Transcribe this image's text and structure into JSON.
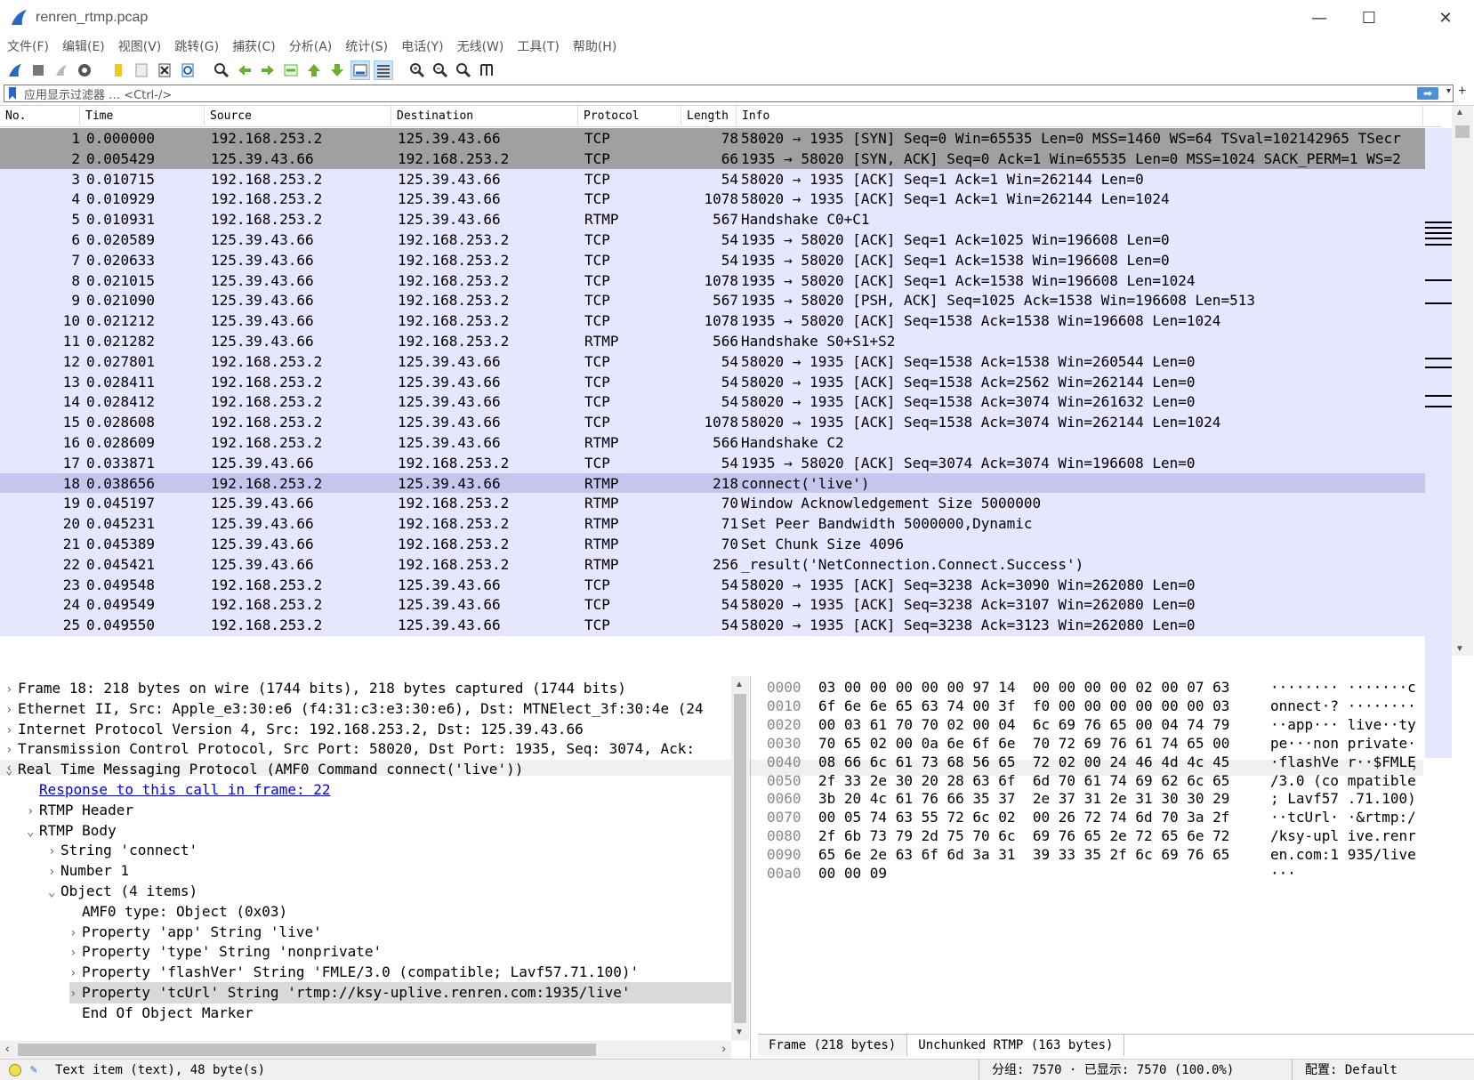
{
  "window": {
    "title": "renren_rtmp.pcap",
    "minimize": "—",
    "maximize": "☐",
    "close": "✕"
  },
  "menu": [
    "文件(F)",
    "编辑(E)",
    "视图(V)",
    "跳转(G)",
    "捕获(C)",
    "分析(A)",
    "统计(S)",
    "电话(Y)",
    "无线(W)",
    "工具(T)",
    "帮助(H)"
  ],
  "filter": {
    "placeholder": "应用显示过滤器 … <Ctrl-/>",
    "apply": "➡",
    "dropdown": "▾",
    "add": "+"
  },
  "packet_list": {
    "columns": [
      "No.",
      "Time",
      "Source",
      "Destination",
      "Protocol",
      "Length",
      "Info"
    ],
    "rows": [
      {
        "no": "1",
        "time": "0.000000",
        "src": "192.168.253.2",
        "dst": "125.39.43.66",
        "proto": "TCP",
        "len": "78",
        "info": "58020 → 1935 [SYN] Seq=0 Win=65535 Len=0 MSS=1460 WS=64 TSval=102142965 TSecr",
        "style": "hl"
      },
      {
        "no": "2",
        "time": "0.005429",
        "src": "125.39.43.66",
        "dst": "192.168.253.2",
        "proto": "TCP",
        "len": "66",
        "info": "1935 → 58020 [SYN, ACK] Seq=0 Ack=1 Win=65535 Len=0 MSS=1024 SACK_PERM=1 WS=2",
        "style": "hl"
      },
      {
        "no": "3",
        "time": "0.010715",
        "src": "192.168.253.2",
        "dst": "125.39.43.66",
        "proto": "TCP",
        "len": "54",
        "info": "58020 → 1935 [ACK] Seq=1 Ack=1 Win=262144 Len=0",
        "style": ""
      },
      {
        "no": "4",
        "time": "0.010929",
        "src": "192.168.253.2",
        "dst": "125.39.43.66",
        "proto": "TCP",
        "len": "1078",
        "info": "58020 → 1935 [ACK] Seq=1 Ack=1 Win=262144 Len=1024",
        "style": ""
      },
      {
        "no": "5",
        "time": "0.010931",
        "src": "192.168.253.2",
        "dst": "125.39.43.66",
        "proto": "RTMP",
        "len": "567",
        "info": "Handshake C0+C1",
        "style": ""
      },
      {
        "no": "6",
        "time": "0.020589",
        "src": "125.39.43.66",
        "dst": "192.168.253.2",
        "proto": "TCP",
        "len": "54",
        "info": "1935 → 58020 [ACK] Seq=1 Ack=1025 Win=196608 Len=0",
        "style": ""
      },
      {
        "no": "7",
        "time": "0.020633",
        "src": "125.39.43.66",
        "dst": "192.168.253.2",
        "proto": "TCP",
        "len": "54",
        "info": "1935 → 58020 [ACK] Seq=1 Ack=1538 Win=196608 Len=0",
        "style": ""
      },
      {
        "no": "8",
        "time": "0.021015",
        "src": "125.39.43.66",
        "dst": "192.168.253.2",
        "proto": "TCP",
        "len": "1078",
        "info": "1935 → 58020 [ACK] Seq=1 Ack=1538 Win=196608 Len=1024",
        "style": ""
      },
      {
        "no": "9",
        "time": "0.021090",
        "src": "125.39.43.66",
        "dst": "192.168.253.2",
        "proto": "TCP",
        "len": "567",
        "info": "1935 → 58020 [PSH, ACK] Seq=1025 Ack=1538 Win=196608 Len=513",
        "style": ""
      },
      {
        "no": "10",
        "time": "0.021212",
        "src": "125.39.43.66",
        "dst": "192.168.253.2",
        "proto": "TCP",
        "len": "1078",
        "info": "1935 → 58020 [ACK] Seq=1538 Ack=1538 Win=196608 Len=1024",
        "style": ""
      },
      {
        "no": "11",
        "time": "0.021282",
        "src": "125.39.43.66",
        "dst": "192.168.253.2",
        "proto": "RTMP",
        "len": "566",
        "info": "Handshake S0+S1+S2",
        "style": ""
      },
      {
        "no": "12",
        "time": "0.027801",
        "src": "192.168.253.2",
        "dst": "125.39.43.66",
        "proto": "TCP",
        "len": "54",
        "info": "58020 → 1935 [ACK] Seq=1538 Ack=1538 Win=260544 Len=0",
        "style": ""
      },
      {
        "no": "13",
        "time": "0.028411",
        "src": "192.168.253.2",
        "dst": "125.39.43.66",
        "proto": "TCP",
        "len": "54",
        "info": "58020 → 1935 [ACK] Seq=1538 Ack=2562 Win=262144 Len=0",
        "style": ""
      },
      {
        "no": "14",
        "time": "0.028412",
        "src": "192.168.253.2",
        "dst": "125.39.43.66",
        "proto": "TCP",
        "len": "54",
        "info": "58020 → 1935 [ACK] Seq=1538 Ack=3074 Win=261632 Len=0",
        "style": ""
      },
      {
        "no": "15",
        "time": "0.028608",
        "src": "192.168.253.2",
        "dst": "125.39.43.66",
        "proto": "TCP",
        "len": "1078",
        "info": "58020 → 1935 [ACK] Seq=1538 Ack=3074 Win=262144 Len=1024",
        "style": ""
      },
      {
        "no": "16",
        "time": "0.028609",
        "src": "192.168.253.2",
        "dst": "125.39.43.66",
        "proto": "RTMP",
        "len": "566",
        "info": "Handshake C2",
        "style": ""
      },
      {
        "no": "17",
        "time": "0.033871",
        "src": "125.39.43.66",
        "dst": "192.168.253.2",
        "proto": "TCP",
        "len": "54",
        "info": "1935 → 58020 [ACK] Seq=3074 Ack=3074 Win=196608 Len=0",
        "style": ""
      },
      {
        "no": "18",
        "time": "0.038656",
        "src": "192.168.253.2",
        "dst": "125.39.43.66",
        "proto": "RTMP",
        "len": "218",
        "info": "connect('live')",
        "style": "sel"
      },
      {
        "no": "19",
        "time": "0.045197",
        "src": "125.39.43.66",
        "dst": "192.168.253.2",
        "proto": "RTMP",
        "len": "70",
        "info": "Window Acknowledgement Size 5000000",
        "style": ""
      },
      {
        "no": "20",
        "time": "0.045231",
        "src": "125.39.43.66",
        "dst": "192.168.253.2",
        "proto": "RTMP",
        "len": "71",
        "info": "Set Peer Bandwidth 5000000,Dynamic",
        "style": ""
      },
      {
        "no": "21",
        "time": "0.045389",
        "src": "125.39.43.66",
        "dst": "192.168.253.2",
        "proto": "RTMP",
        "len": "70",
        "info": "Set Chunk Size 4096",
        "style": ""
      },
      {
        "no": "22",
        "time": "0.045421",
        "src": "125.39.43.66",
        "dst": "192.168.253.2",
        "proto": "RTMP",
        "len": "256",
        "info": "_result('NetConnection.Connect.Success')",
        "style": ""
      },
      {
        "no": "23",
        "time": "0.049548",
        "src": "192.168.253.2",
        "dst": "125.39.43.66",
        "proto": "TCP",
        "len": "54",
        "info": "58020 → 1935 [ACK] Seq=3238 Ack=3090 Win=262080 Len=0",
        "style": ""
      },
      {
        "no": "24",
        "time": "0.049549",
        "src": "192.168.253.2",
        "dst": "125.39.43.66",
        "proto": "TCP",
        "len": "54",
        "info": "58020 → 1935 [ACK] Seq=3238 Ack=3107 Win=262080 Len=0",
        "style": ""
      },
      {
        "no": "25",
        "time": "0.049550",
        "src": "192.168.253.2",
        "dst": "125.39.43.66",
        "proto": "TCP",
        "len": "54",
        "info": "58020 → 1935 [ACK] Seq=3238 Ack=3123 Win=262080 Len=0",
        "style": ""
      }
    ]
  },
  "details": [
    {
      "indent": 0,
      "arrow": "›",
      "text": "Frame 18: 218 bytes on wire (1744 bits), 218 bytes captured (1744 bits)"
    },
    {
      "indent": 0,
      "arrow": "›",
      "text": "Ethernet II, Src: Apple_e3:30:e6 (f4:31:c3:e3:30:e6), Dst: MTNElect_3f:30:4e (24"
    },
    {
      "indent": 0,
      "arrow": "›",
      "text": "Internet Protocol Version 4, Src: 192.168.253.2, Dst: 125.39.43.66"
    },
    {
      "indent": 0,
      "arrow": "›",
      "text": "Transmission Control Protocol, Src Port: 58020, Dst Port: 1935, Seq: 3074, Ack:"
    },
    {
      "indent": 0,
      "arrow": "⌄",
      "text": "Real Time Messaging Protocol (AMF0 Command connect('live'))"
    },
    {
      "indent": 1,
      "arrow": "",
      "text": "Response to this call in frame: 22",
      "link": true
    },
    {
      "indent": 1,
      "arrow": "›",
      "text": "RTMP Header"
    },
    {
      "indent": 1,
      "arrow": "⌄",
      "text": "RTMP Body"
    },
    {
      "indent": 2,
      "arrow": "›",
      "text": "String 'connect'"
    },
    {
      "indent": 2,
      "arrow": "›",
      "text": "Number 1"
    },
    {
      "indent": 2,
      "arrow": "⌄",
      "text": "Object (4 items)"
    },
    {
      "indent": 3,
      "arrow": "",
      "text": "AMF0 type: Object (0x03)"
    },
    {
      "indent": 3,
      "arrow": "›",
      "text": "Property 'app' String 'live'"
    },
    {
      "indent": 3,
      "arrow": "›",
      "text": "Property 'type' String 'nonprivate'"
    },
    {
      "indent": 3,
      "arrow": "›",
      "text": "Property 'flashVer' String 'FMLE/3.0 (compatible; Lavf57.71.100)'"
    },
    {
      "indent": 3,
      "arrow": "›",
      "text": "Property 'tcUrl' String 'rtmp://ksy-uplive.renren.com:1935/live'",
      "sel": true
    },
    {
      "indent": 3,
      "arrow": "",
      "text": "End Of Object Marker"
    }
  ],
  "bytes": [
    {
      "off": "0000",
      "hex": "03 00 00 00 00 00 97 14  00 00 00 00 02 00 07 63",
      "ascii": "········ ·······c"
    },
    {
      "off": "0010",
      "hex": "6f 6e 6e 65 63 74 00 3f  f0 00 00 00 00 00 00 03",
      "ascii": "onnect·? ········"
    },
    {
      "off": "0020",
      "hex": "00 03 61 70 70 02 00 04  6c 69 76 65 00 04 74 79",
      "ascii": "··app··· live··ty"
    },
    {
      "off": "0030",
      "hex": "70 65 02 00 0a 6e 6f 6e  70 72 69 76 61 74 65 00",
      "ascii": "pe···non private·"
    },
    {
      "off": "0040",
      "hex": "08 66 6c 61 73 68 56 65  72 02 00 24 46 4d 4c 45",
      "ascii": "·flashVe r··$FMLE"
    },
    {
      "off": "0050",
      "hex": "2f 33 2e 30 20 28 63 6f  6d 70 61 74 69 62 6c 65",
      "ascii": "/3.0 (co mpatible"
    },
    {
      "off": "0060",
      "hex": "3b 20 4c 61 76 66 35 37  2e 37 31 2e 31 30 30 29",
      "ascii": "; Lavf57 .71.100)"
    },
    {
      "off": "0070",
      "hex": "00 05 74 63 55 72 6c 02  00 26 72 74 6d 70 3a 2f",
      "ascii": "··tcUrl· ·&rtmp:/"
    },
    {
      "off": "0080",
      "hex": "2f 6b 73 79 2d 75 70 6c  69 76 65 2e 72 65 6e 72",
      "ascii": "/ksy-upl ive.renr"
    },
    {
      "off": "0090",
      "hex": "65 6e 2e 63 6f 6d 3a 31  39 33 35 2f 6c 69 76 65",
      "ascii": "en.com:1 935/live"
    },
    {
      "off": "00a0",
      "hex": "00 00 09",
      "ascii": "···"
    }
  ],
  "bytes_tabs": [
    "Frame (218 bytes)",
    "Unchunked RTMP (163 bytes)"
  ],
  "status": {
    "left": "Text item (text), 48 byte(s)",
    "packets": "分组: 7570 · 已显示: 7570 (100.0%)",
    "profile": "配置: Default"
  },
  "colors": {
    "row_bg": "#e7e6ff",
    "highlight_row": "#a0a0a0",
    "selected_row": "#c6c5ee"
  }
}
